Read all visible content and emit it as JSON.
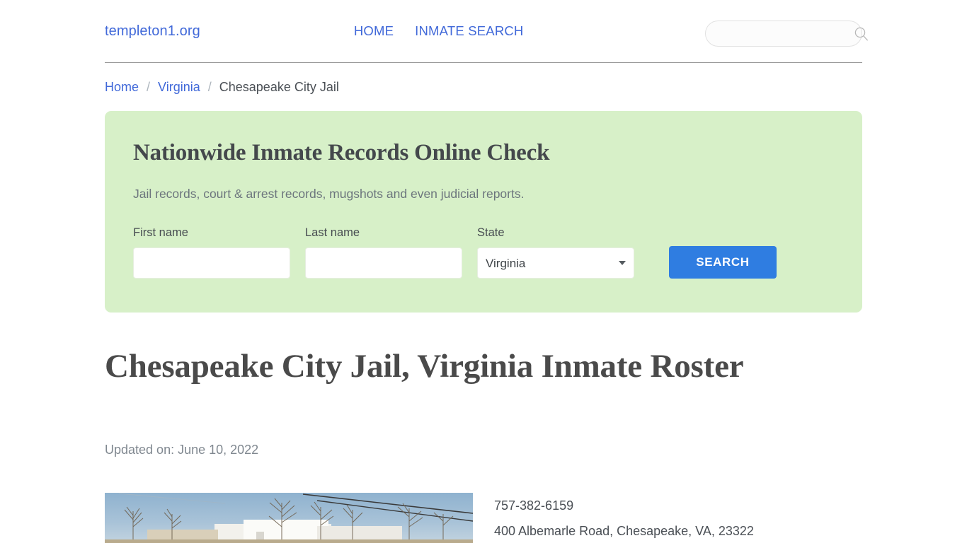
{
  "header": {
    "brand": "templeton1.org",
    "nav": [
      {
        "label": "HOME"
      },
      {
        "label": "INMATE SEARCH"
      }
    ],
    "search": {
      "value": "",
      "placeholder": "",
      "icon": "search-icon"
    }
  },
  "breadcrumb": {
    "items": [
      {
        "label": "Home",
        "link": true
      },
      {
        "label": "Virginia",
        "link": true
      },
      {
        "label": "Chesapeake City Jail",
        "link": false
      }
    ],
    "separator": "/"
  },
  "promo": {
    "title": "Nationwide Inmate Records Online Check",
    "subtitle": "Jail records, court & arrest records, mugshots and even judicial reports.",
    "background_color": "#d7f0c8",
    "fields": {
      "first_name_label": "First name",
      "first_name_value": "",
      "first_name_placeholder": "",
      "last_name_label": "Last name",
      "last_name_value": "",
      "last_name_placeholder": "",
      "state_label": "State",
      "state_value": "Virginia",
      "state_options": [
        "Virginia"
      ]
    },
    "search_button": "SEARCH",
    "search_button_color": "#2f7de1"
  },
  "main": {
    "title": "Chesapeake City Jail, Virginia Inmate Roster",
    "updated": "Updated on: June 10, 2022",
    "facility": {
      "photo_alt": "Chesapeake City Jail building photo",
      "phone": "757-382-6159",
      "address": "400 Albemarle Road, Chesapeake, VA, 23322"
    }
  }
}
